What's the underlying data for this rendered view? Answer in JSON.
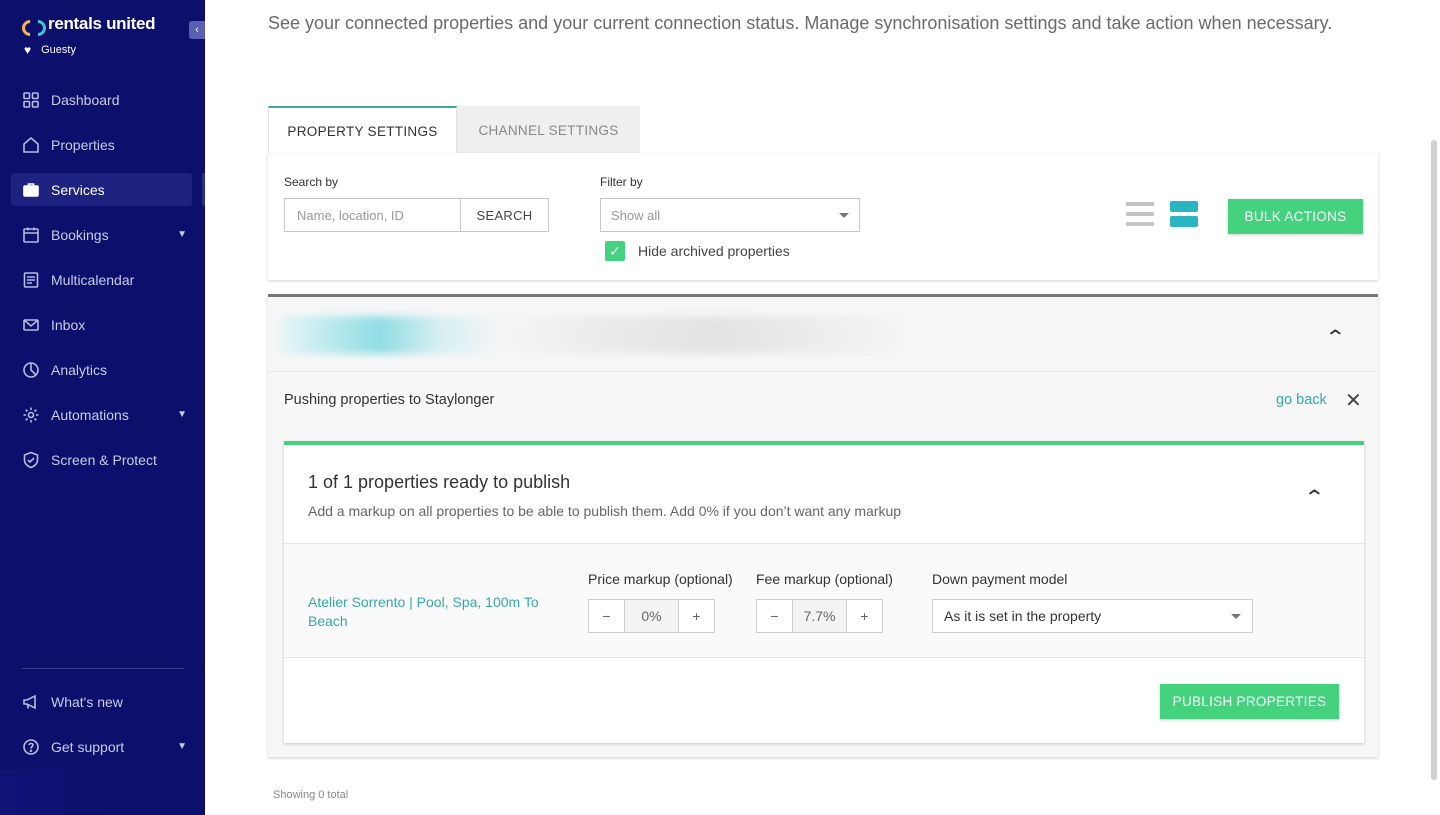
{
  "sidebar": {
    "brand": "rentals united",
    "org": "Guesty",
    "collapse_icon": "‹",
    "items": [
      {
        "label": "Dashboard",
        "icon": "dashboard-icon"
      },
      {
        "label": "Properties",
        "icon": "home-icon"
      },
      {
        "label": "Services",
        "icon": "briefcase-icon",
        "active": true
      },
      {
        "label": "Bookings",
        "icon": "calendar-icon",
        "expandable": true
      },
      {
        "label": "Multicalendar",
        "icon": "multicalendar-icon"
      },
      {
        "label": "Inbox",
        "icon": "mail-icon"
      },
      {
        "label": "Analytics",
        "icon": "pie-chart-icon"
      },
      {
        "label": "Automations",
        "icon": "gear-icon",
        "expandable": true
      },
      {
        "label": "Screen & Protect",
        "icon": "shield-icon"
      }
    ],
    "bottom_items": [
      {
        "label": "What's new",
        "icon": "megaphone-icon"
      },
      {
        "label": "Get support",
        "icon": "help-icon",
        "expandable": true
      }
    ]
  },
  "main": {
    "intro": "See your connected properties and your current connection status. Manage synchronisation settings and take action when necessary.",
    "tabs": [
      {
        "label": "PROPERTY SETTINGS",
        "active": true
      },
      {
        "label": "CHANNEL SETTINGS",
        "active": false
      }
    ],
    "filters": {
      "search_label": "Search by",
      "search_placeholder": "Name, location, ID",
      "search_button": "SEARCH",
      "filter_label": "Filter by",
      "filter_value": "Show all",
      "hide_archived_label": "Hide archived properties",
      "hide_archived_checked": true,
      "bulk_actions": "BULK ACTIONS"
    },
    "push": {
      "title": "Pushing properties to Staylonger",
      "go_back": "go back",
      "ready_title": "1 of 1 properties ready to publish",
      "ready_subtitle": "Add a markup on all properties to be able to publish them. Add 0% if you don’t want any markup",
      "property": {
        "name": "Atelier Sorrento | Pool, Spa, 100m To Beach",
        "price_markup_label": "Price markup (optional)",
        "price_markup_value": "0%",
        "fee_markup_label": "Fee markup (optional)",
        "fee_markup_value": "7.7%",
        "down_payment_label": "Down payment model",
        "down_payment_value": "As it is set in the property"
      },
      "publish_button": "PUBLISH PROPERTIES"
    },
    "footer": "Showing 0 total"
  },
  "colors": {
    "sidebar_bg": "#0c0f6b",
    "accent_green": "#44d27f",
    "accent_teal": "#36a9a6"
  }
}
